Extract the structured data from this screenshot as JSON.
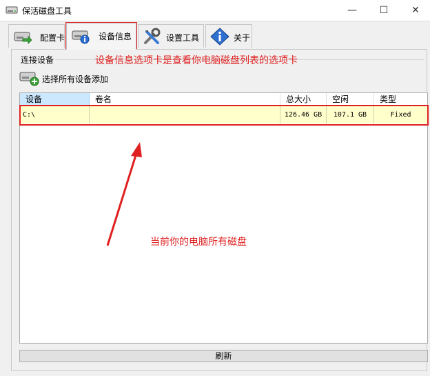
{
  "window": {
    "title": "保活磁盘工具",
    "minimize": "—",
    "maximize": "☐",
    "close": "✕"
  },
  "tabs": [
    {
      "label": "配置卡",
      "icon": "drive-arrow-icon"
    },
    {
      "label": "设备信息",
      "icon": "drive-info-icon"
    },
    {
      "label": "设置工具",
      "icon": "tools-icon"
    },
    {
      "label": "关于",
      "icon": "info-diamond-icon"
    }
  ],
  "active_tab": "设备信息",
  "panel": {
    "group_caption": "连接设备",
    "add_button_label": "选择所有设备添加",
    "columns": [
      "设备",
      "卷名",
      "总大小",
      "空闲",
      "类型"
    ],
    "rows": [
      {
        "device": "C:\\",
        "volume": "",
        "total": "126.46 GB",
        "free": "107.1 GB",
        "type": "Fixed"
      }
    ],
    "refresh_label": "刷新"
  },
  "annotations": {
    "tab_note": "设备信息选项卡是查看你电脑磁盘列表的选项卡",
    "disk_note": "当前你的电脑所有磁盘",
    "color": "#e02020"
  }
}
